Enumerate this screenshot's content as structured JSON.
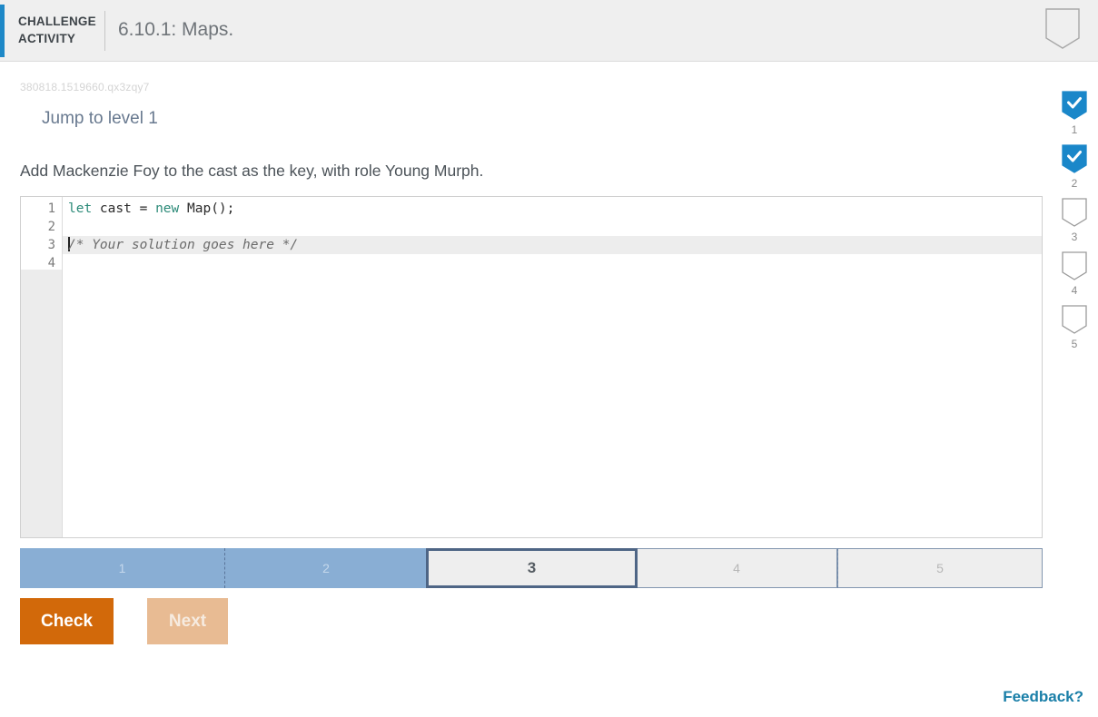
{
  "header": {
    "label_line1": "CHALLENGE",
    "label_line2": "ACTIVITY",
    "title": "6.10.1: Maps.",
    "bookmark_icon": "bookmark-outline-icon",
    "accent_color": "#1e88c7"
  },
  "activity_id": "380818.1519660.qx3zqy7",
  "jump_link": "Jump to level 1",
  "prompt": "Add Mackenzie Foy to the cast as the key, with role Young Murph.",
  "editor": {
    "line_numbers": [
      "1",
      "2",
      "3",
      "4"
    ],
    "lines": [
      {
        "number": "1",
        "tokens": [
          {
            "text": "let",
            "type": "keyword"
          },
          {
            "text": " cast ",
            "type": "plain"
          },
          {
            "text": "=",
            "type": "punct"
          },
          {
            "text": " ",
            "type": "plain"
          },
          {
            "text": "new",
            "type": "keyword"
          },
          {
            "text": " Map",
            "type": "plain"
          },
          {
            "text": "();",
            "type": "punct"
          }
        ]
      },
      {
        "number": "2",
        "tokens": []
      },
      {
        "number": "3",
        "active": true,
        "cursor": true,
        "tokens": [
          {
            "text": "/* Your solution goes here */",
            "type": "comment"
          }
        ]
      },
      {
        "number": "4",
        "tokens": []
      }
    ]
  },
  "progress": {
    "segments": [
      {
        "label": "1",
        "state": "done"
      },
      {
        "label": "2",
        "state": "done"
      },
      {
        "label": "3",
        "state": "current"
      },
      {
        "label": "4",
        "state": "todo"
      },
      {
        "label": "5",
        "state": "todo"
      }
    ],
    "done_color": "#89aed4",
    "current_border": "#4e6585",
    "todo_color": "#eeeeee"
  },
  "buttons": {
    "check": "Check",
    "next": "Next",
    "check_color": "#d2690a",
    "next_color": "#e8bb93"
  },
  "rail": {
    "items": [
      {
        "number": "1",
        "checked": true
      },
      {
        "number": "2",
        "checked": true
      },
      {
        "number": "3",
        "checked": false
      },
      {
        "number": "4",
        "checked": false
      },
      {
        "number": "5",
        "checked": false
      }
    ],
    "checked_color": "#1a87c9",
    "icon": "ribbon-check-icon"
  },
  "feedback": "Feedback?"
}
